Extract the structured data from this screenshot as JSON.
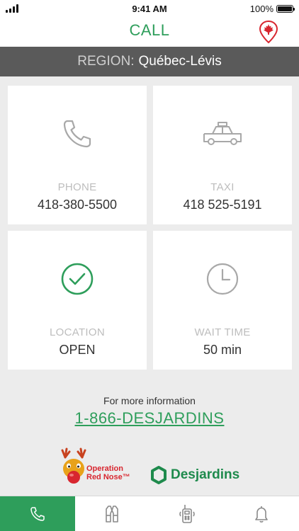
{
  "status_bar": {
    "time": "9:41 AM",
    "battery": "100%"
  },
  "header": {
    "title": "CALL",
    "region_label": "REGION:",
    "region_value": "Québec-Lévis"
  },
  "tiles": [
    {
      "label": "PHONE",
      "value": "418-380-5500",
      "icon": "phone-icon"
    },
    {
      "label": "TAXI",
      "value": "418 525-5191",
      "icon": "taxi-icon"
    },
    {
      "label": "LOCATION",
      "value": "OPEN",
      "icon": "check-circle-icon"
    },
    {
      "label": "WAIT TIME",
      "value": "50 min",
      "icon": "clock-icon"
    }
  ],
  "info": {
    "text": "For more information",
    "phone": "1-866-DESJARDINS"
  },
  "logos": {
    "operation_red_nose": [
      "Operation",
      "Red Nose™"
    ],
    "desjardins": "Desjardins"
  },
  "tab_bar": {
    "tabs": [
      {
        "icon": "phone-icon",
        "active": true
      },
      {
        "icon": "vest-icon",
        "active": false
      },
      {
        "icon": "walkie-talkie-icon",
        "active": false
      },
      {
        "icon": "bell-icon",
        "active": false
      }
    ]
  },
  "colors": {
    "accent": "#2e9e5b",
    "region_bar": "#5a5a5a",
    "red": "#d8262f"
  }
}
